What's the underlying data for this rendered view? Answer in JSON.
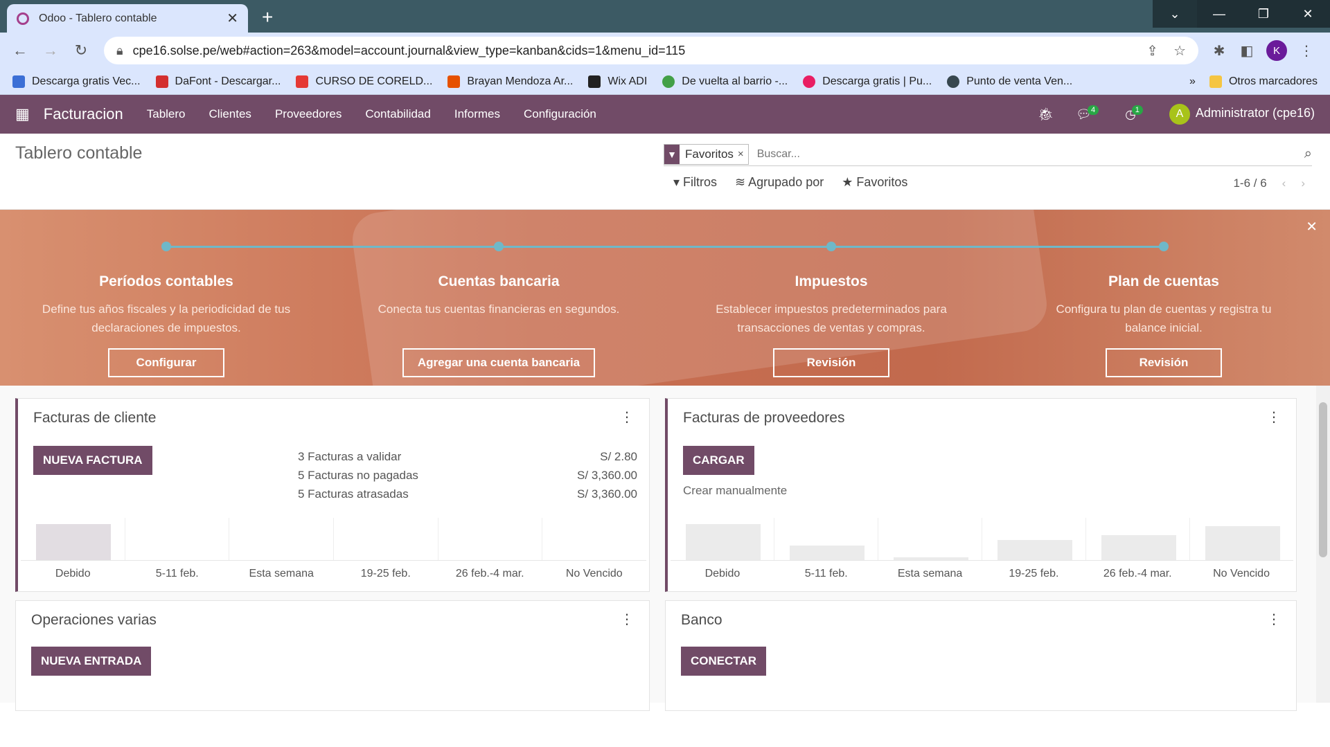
{
  "browser": {
    "tab_title": "Odoo - Tablero contable",
    "url": "cpe16.solse.pe/web#action=263&model=account.journal&view_type=kanban&cids=1&menu_id=115",
    "profile_initial": "K",
    "bookmarks": [
      {
        "label": "Descarga gratis Vec...",
        "color": "#3b6fd6"
      },
      {
        "label": "DaFont - Descargar...",
        "color": "#d32f2f"
      },
      {
        "label": "CURSO DE CORELD...",
        "color": "#e53935"
      },
      {
        "label": "Brayan Mendoza Ar...",
        "color": "#e65100"
      },
      {
        "label": "Wix ADI",
        "color": "#222222"
      },
      {
        "label": "De vuelta al barrio -...",
        "color": "#43a047"
      },
      {
        "label": "Descarga gratis | Pu...",
        "color": "#e91e63"
      },
      {
        "label": "Punto de venta Ven...",
        "color": "#37474f"
      }
    ],
    "bookmarks_more": "»",
    "other_bookmarks": "Otros marcadores"
  },
  "odoo_nav": {
    "app_name": "Facturacion",
    "menu": [
      "Tablero",
      "Clientes",
      "Proveedores",
      "Contabilidad",
      "Informes",
      "Configuración"
    ],
    "messages_count": "4",
    "activities_count": "1",
    "user_initial": "A",
    "user_name": "Administrator (cpe16)"
  },
  "control_panel": {
    "title": "Tablero contable",
    "facet": "Favoritos",
    "search_placeholder": "Buscar...",
    "filters": "Filtros",
    "group_by": "Agrupado por",
    "favorites": "Favoritos",
    "pager": "1-6 / 6"
  },
  "onboarding": {
    "steps": [
      {
        "title": "Períodos contables",
        "desc": "Define tus años fiscales y la periodicidad de tus declaraciones de impuestos.",
        "button": "Configurar"
      },
      {
        "title": "Cuentas bancaria",
        "desc": "Conecta tus cuentas financieras en segundos.",
        "button": "Agregar una cuenta bancaria"
      },
      {
        "title": "Impuestos",
        "desc": "Establecer impuestos predeterminados para transacciones de ventas y compras.",
        "button": "Revisión"
      },
      {
        "title": "Plan de cuentas",
        "desc": "Configura tu plan de cuentas y registra tu balance inicial.",
        "button": "Revisión"
      }
    ]
  },
  "cards": {
    "customer": {
      "title": "Facturas de cliente",
      "button": "NUEVA FACTURA",
      "stats": [
        {
          "label": "3 Facturas a validar",
          "value": "S/ 2.80"
        },
        {
          "label": "5 Facturas no pagadas",
          "value": "S/ 3,360.00"
        },
        {
          "label": "5 Facturas atrasadas",
          "value": "S/ 3,360.00"
        }
      ]
    },
    "vendor": {
      "title": "Facturas de proveedores",
      "button": "CARGAR",
      "link": "Crear manualmente"
    },
    "misc": {
      "title": "Operaciones varias",
      "button": "NUEVA ENTRADA"
    },
    "bank": {
      "title": "Banco",
      "button": "CONECTAR"
    }
  },
  "chart_data": [
    {
      "type": "bar",
      "categories": [
        "Debido",
        "5-11 feb.",
        "Esta semana",
        "19-25 feb.",
        "26 feb.-4 mar.",
        "No Vencido"
      ],
      "values": [
        1,
        0,
        0,
        0,
        0,
        0
      ],
      "colors": [
        "#e2dde2",
        "#e8e8e8",
        "#e8e8e8",
        "#e8e8e8",
        "#e8e8e8",
        "#e8e8e8"
      ]
    },
    {
      "type": "bar",
      "categories": [
        "Debido",
        "5-11 feb.",
        "Esta semana",
        "19-25 feb.",
        "26 feb.-4 mar.",
        "No Vencido"
      ],
      "values": [
        1.0,
        0.4,
        0.08,
        0.55,
        0.7,
        0.95
      ],
      "colors": [
        "#ebebeb",
        "#ebebeb",
        "#ebebeb",
        "#ebebeb",
        "#ebebeb",
        "#ebebeb"
      ]
    }
  ]
}
